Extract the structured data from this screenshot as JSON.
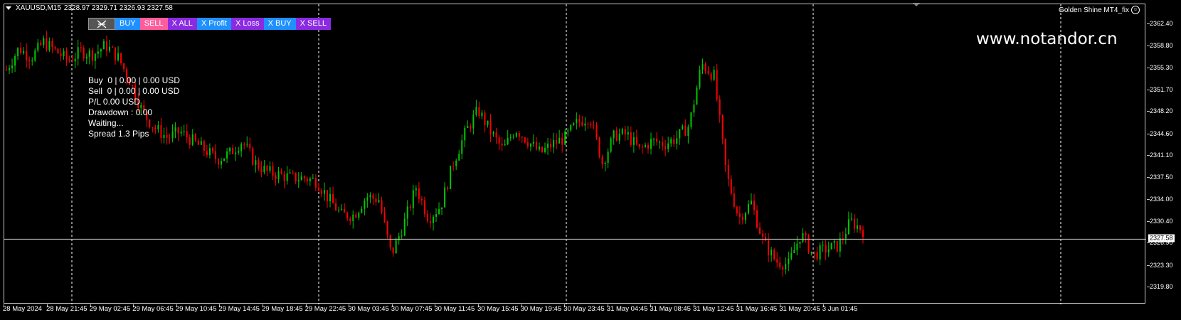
{
  "header": {
    "symbol": "XAUUSD,M15",
    "ohlc": "2328.97 2329.71 2326.93 2327.58",
    "ea_name": "Golden Shine MT4_fix"
  },
  "toolbar": {
    "buy": "BUY",
    "sell": "SELL",
    "close_all": "X ALL",
    "close_profit": "X Profit",
    "close_loss": "X Loss",
    "close_buy": "X BUY",
    "close_sell": "X SELL"
  },
  "info": {
    "buy_line": "Buy  0 | 0.00 | 0.00 USD",
    "sell_line": "Sell  0 | 0.00 | 0.00 USD",
    "pl_line": "P/L 0.00 USD",
    "drawdown_line": "Drawdown : 0.00",
    "status_line": "Waiting...",
    "spread_line": "Spread 1.3 Pips"
  },
  "watermark": "www.notandor.cn",
  "colors": {
    "bull": "#00c800",
    "bear": "#ff0000",
    "grid": "#ffffff",
    "background": "#000000"
  },
  "price_axis": {
    "labels": [
      "2362.40",
      "2358.80",
      "2355.30",
      "2351.70",
      "2348.20",
      "2344.60",
      "2341.10",
      "2337.50",
      "2334.00",
      "2330.40",
      "2326.90",
      "2323.30",
      "2319.80"
    ],
    "current": "2327.58"
  },
  "time_axis": {
    "labels": [
      "28 May 2024",
      "28 May 21:45",
      "29 May 02:45",
      "29 May 06:45",
      "29 May 10:45",
      "29 May 14:45",
      "29 May 18:45",
      "29 May 22:45",
      "30 May 03:45",
      "30 May 07:45",
      "30 May 11:45",
      "30 May 15:45",
      "30 May 19:45",
      "30 May 23:45",
      "31 May 04:45",
      "31 May 08:45",
      "31 May 12:45",
      "31 May 16:45",
      "31 May 20:45",
      "3 Jun 01:45"
    ]
  },
  "chart_data": {
    "type": "candlestick",
    "symbol": "XAUUSD",
    "timeframe": "M15",
    "ylim": [
      2319.8,
      2362.4
    ],
    "current_price": 2327.58,
    "close_path_anchors": [
      2355.0,
      2358.5,
      2357.0,
      2359.5,
      2358.0,
      2356.5,
      2358.0,
      2357.5,
      2359.0,
      2357.0,
      2353.0,
      2348.0,
      2345.5,
      2344.0,
      2345.0,
      2343.5,
      2342.0,
      2340.5,
      2341.5,
      2343.5,
      2340.0,
      2338.5,
      2338.0,
      2337.5,
      2337.5,
      2337.0,
      2334.0,
      2331.5,
      2331.5,
      2334.5,
      2334.0,
      2325.0,
      2330.0,
      2336.0,
      2331.0,
      2333.0,
      2340.0,
      2345.0,
      2348.5,
      2345.0,
      2342.0,
      2345.5,
      2343.5,
      2341.5,
      2343.0,
      2344.0,
      2346.5,
      2347.5,
      2340.0,
      2344.5,
      2344.5,
      2342.0,
      2343.5,
      2343.0,
      2344.0,
      2346.0,
      2356.0,
      2354.0,
      2338.0,
      2331.0,
      2333.5,
      2327.0,
      2324.0,
      2323.5,
      2328.5,
      2325.0,
      2326.0,
      2326.5,
      2330.5,
      2329.0
    ]
  }
}
